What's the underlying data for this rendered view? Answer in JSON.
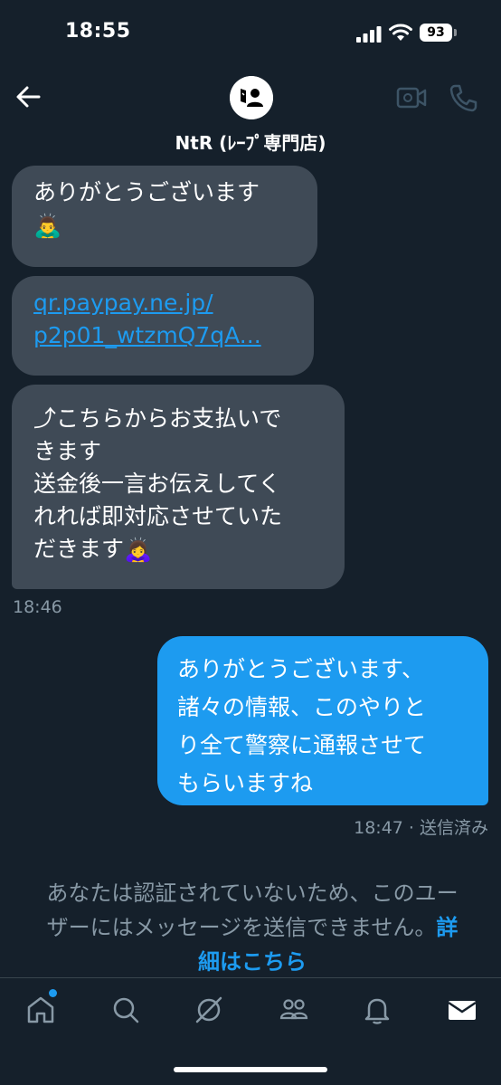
{
  "status_bar": {
    "time": "18:55",
    "battery": "93"
  },
  "header": {
    "title": "NtR (ﾚｰﾌﾟ専門店)"
  },
  "messages": {
    "m1": {
      "text": "ありがとうございます",
      "emoji": "🙇‍♂️"
    },
    "m2": {
      "link_line1": "qr.paypay.ne.jp/",
      "link_line2": "p2p01_wtzmQ7qA..."
    },
    "m3": {
      "line1": "⤴こちらからお支払いで",
      "line2": "きます",
      "line3": "送金後一言お伝えしてく",
      "line4": "れれば即対応させていた",
      "line5": "だきます",
      "emoji": "🙇‍♀️"
    },
    "incoming_time": "18:46",
    "m4": {
      "line1": "ありがとうございます、",
      "line2": "諸々の情報、このやりと",
      "line3": "り全て警察に通報させて",
      "line4": "もらいますね"
    },
    "outgoing_status": "18:47 · 送信済み"
  },
  "notice": {
    "line1": "あなたは認証されていないため、このユー",
    "line2": "ザーにはメッセージを送信できません。",
    "link_a": "詳",
    "link_b": "細はこちら"
  },
  "colors": {
    "background": "#15202b",
    "incoming_bubble": "#3f4a56",
    "outgoing_bubble": "#1d9bf0",
    "muted": "#8899a6"
  },
  "tabs": [
    "home-icon",
    "search-icon",
    "grok-icon",
    "communities-icon",
    "bell-icon",
    "mail-icon"
  ]
}
